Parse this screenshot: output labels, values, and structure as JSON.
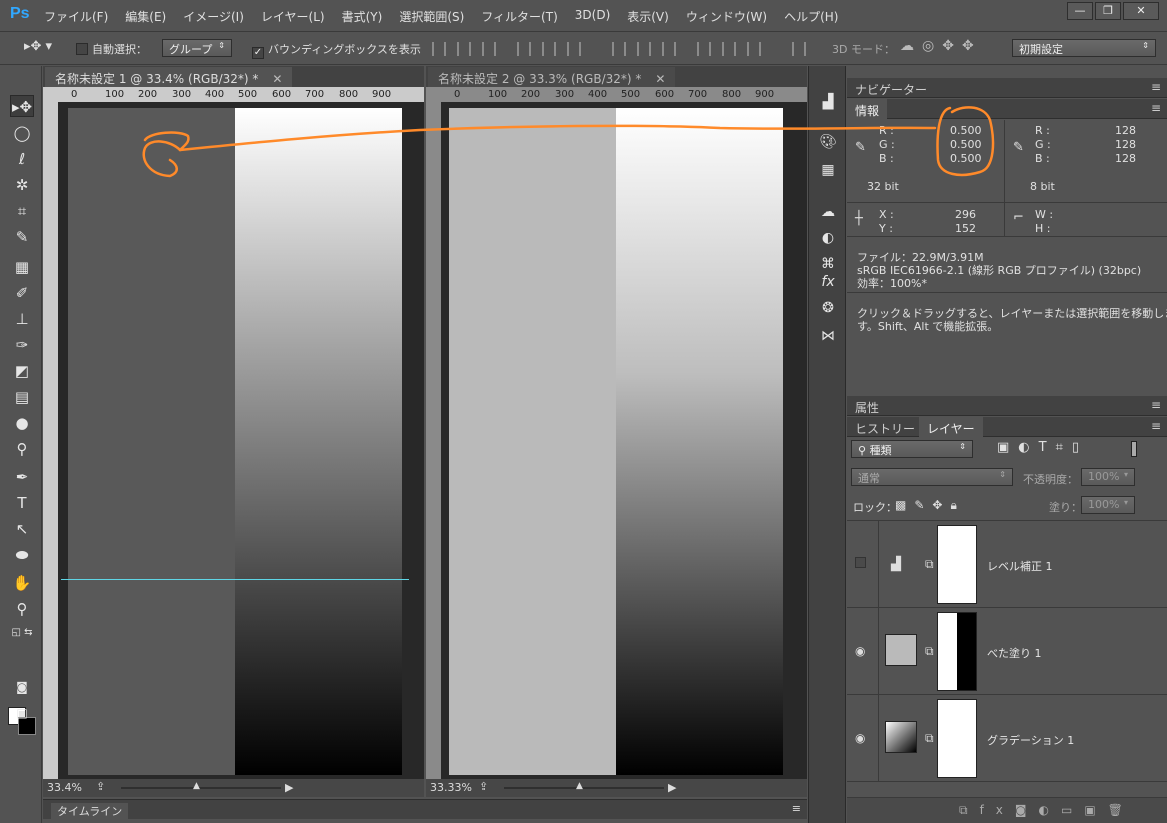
{
  "app": {
    "logo": "Ps"
  },
  "menu": [
    "ファイル(F)",
    "編集(E)",
    "イメージ(I)",
    "レイヤー(L)",
    "書式(Y)",
    "選択範囲(S)",
    "フィルター(T)",
    "3D(D)",
    "表示(V)",
    "ウィンドウ(W)",
    "ヘルプ(H)"
  ],
  "window_controls": {
    "minimize": "—",
    "restore": "❐",
    "close": "✕"
  },
  "options": {
    "auto_select_label": "自動選択：",
    "auto_select_target": "グループ",
    "bounding_box_label": "バウンディングボックスを表示",
    "mode3d_label": "3D モード：",
    "workspace": "初期設定"
  },
  "documents": [
    {
      "tab_title": "名称未設定 1 @ 33.4% (RGB/32*) *",
      "zoom": "33.4%",
      "ruler": [
        "0",
        "100",
        "200",
        "300",
        "400",
        "500",
        "600",
        "700",
        "800",
        "900"
      ]
    },
    {
      "tab_title": "名称未設定 2 @ 33.3% (RGB/32*) *",
      "zoom": "33.33%",
      "ruler": [
        "0",
        "100",
        "200",
        "300",
        "400",
        "500",
        "600",
        "700",
        "800",
        "900"
      ]
    }
  ],
  "timeline": {
    "label": "タイムライン"
  },
  "panels": {
    "navigator_tab": "ナビゲーター",
    "info_tab": "情報",
    "properties_tab": "属性",
    "history_tab": "ヒストリー",
    "layers_tab": "レイヤー"
  },
  "info": {
    "left": {
      "r_label": "R :",
      "g_label": "G :",
      "b_label": "B :",
      "r": "0.500",
      "g": "0.500",
      "b": "0.500",
      "depth": "32 bit"
    },
    "right": {
      "r_label": "R :",
      "g_label": "G :",
      "b_label": "B :",
      "r": "128",
      "g": "128",
      "b": "128",
      "depth": "8 bit"
    },
    "x_label": "X :",
    "y_label": "Y :",
    "x": "296",
    "y": "152",
    "w_label": "W :",
    "h_label": "H :",
    "file_line": "ファイル：22.9M/3.91M",
    "profile_line": "sRGB IEC61966-2.1 (線形 RGB プロファイル) (32bpc)",
    "efficiency_line": "効率：100%*",
    "hint_line1": "クリック＆ドラッグすると、レイヤーまたは選択範囲を移動しま",
    "hint_line2": "す。Shift、Alt で機能拡張。"
  },
  "layers_panel": {
    "filter_kind": "種類",
    "blend_mode": "通常",
    "opacity_label": "不透明度：",
    "opacity": "100%",
    "lock_label": "ロック：",
    "fill_label": "塗り：",
    "fill": "100%",
    "layers": [
      {
        "name": "レベル補正 1",
        "visible": false
      },
      {
        "name": "べた塗り 1",
        "visible": true
      },
      {
        "name": "グラデーション 1",
        "visible": true
      }
    ]
  },
  "colors": {
    "annotation": "#ff8a2a",
    "guide": "#5fd6e6"
  }
}
